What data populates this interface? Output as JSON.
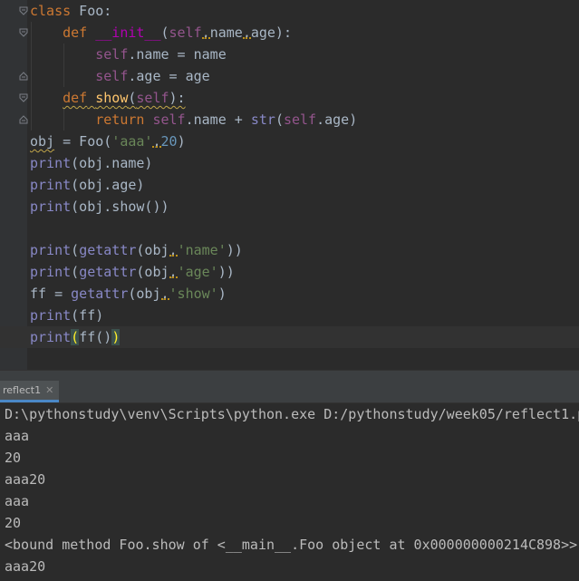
{
  "editor": {
    "lines": [
      "class Foo:",
      "    def __init__(self,name,age):",
      "        self.name = name",
      "        self.age = age",
      "    def show(self):",
      "        return self.name + str(self.age)",
      "obj = Foo('aaa',20)",
      "print(obj.name)",
      "print(obj.age)",
      "print(obj.show())",
      "",
      "print(getattr(obj,'name'))",
      "print(getattr(obj,'age'))",
      "ff = getattr(obj,'show')",
      "print(ff)",
      "print(ff())"
    ],
    "current_line": 16
  },
  "run_panel": {
    "tab_label": "reflect1",
    "close_icon": "close-icon",
    "accent": "#4a88c7",
    "output": [
      "D:\\pythonstudy\\venv\\Scripts\\python.exe D:/pythonstudy/week05/reflect1.py",
      "aaa",
      "20",
      "aaa20",
      "aaa",
      "20",
      "<bound method Foo.show of <__main__.Foo object at 0x000000000214C898>>",
      "aaa20"
    ]
  },
  "colors": {
    "editor_bg": "#2b2b2b",
    "gutter_bg": "#313335",
    "keyword": "#cc7832",
    "function": "#ffc66d",
    "self": "#94558d",
    "string": "#6a8759",
    "number": "#6897bb",
    "builtin": "#8888c6"
  }
}
